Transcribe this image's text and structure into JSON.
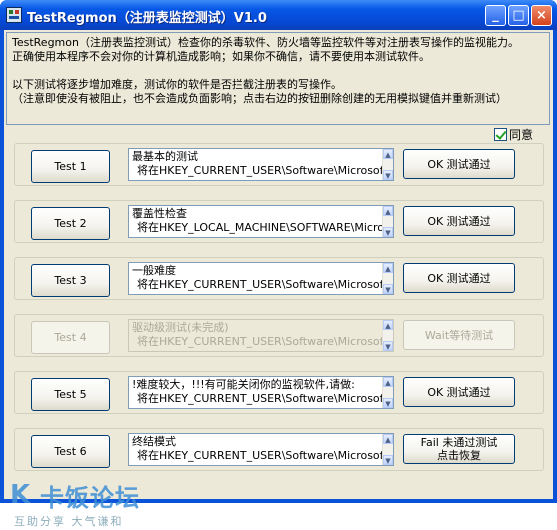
{
  "window": {
    "title": "TestRegmon（注册表监控测试）V1.0",
    "controls": {
      "minimize": "_",
      "maximize": "□",
      "close": "×"
    }
  },
  "info": {
    "lines": [
      "TestRegmon（注册表监控测试）检查你的杀毒软件、防火墙等监控软件等对注册表写操作的监视能力。",
      "正确使用本程序不会对你的计算机造成影响；如果你不确信，请不要使用本测试软件。",
      "",
      "以下测试将逐步增加难度，测试你的软件是否拦截注册表的写操作。",
      "（注意即使没有被阻止，也不会造成负面影响；点击右边的按钮删除创建的无用模拟键值并重新测试）"
    ]
  },
  "agree": {
    "label": "同意",
    "checked": true
  },
  "tests": [
    {
      "button": "Test 1",
      "name": "最基本的测试",
      "path": "将在HKEY_CURRENT_USER\\Software\\Microsoft\\W",
      "result": "OK 测试通过",
      "enabled": true
    },
    {
      "button": "Test 2",
      "name": "覆盖性检查",
      "path": "将在HKEY_LOCAL_MACHINE\\SOFTWARE\\Microsc",
      "result": "OK 测试通过",
      "enabled": true
    },
    {
      "button": "Test 3",
      "name": "一般难度",
      "path": "将在HKEY_CURRENT_USER\\Software\\Microsoft\\W",
      "result": "OK 测试通过",
      "enabled": true
    },
    {
      "button": "Test 4",
      "name": "驱动级测试(未完成)",
      "path": "将在HKEY_CURRENT_USER\\Software\\Microsoft\\W",
      "result": "Wait等待测试",
      "enabled": false
    },
    {
      "button": "Test 5",
      "name": "!难度较大，!!!有可能关闭你的监视软件,请做:",
      "path": "将在HKEY_CURRENT_USER\\Software\\Microsoft\\W",
      "result": "OK 测试通过",
      "enabled": true
    },
    {
      "button": "Test 6",
      "name": "终结模式",
      "path": "将在HKEY_CURRENT_USER\\Software\\Microsoft\\W",
      "result": "Fail 未通过测试",
      "result2": "点击恢复",
      "enabled": true
    }
  ],
  "watermark": {
    "mark": "K",
    "name": "卡饭论坛",
    "slogan": "互助分享  大气谦和"
  },
  "icons": [
    "registry-app-icon",
    "checkbox-checked-icon",
    "scroll-up-arrow-icon",
    "scroll-down-arrow-icon"
  ]
}
